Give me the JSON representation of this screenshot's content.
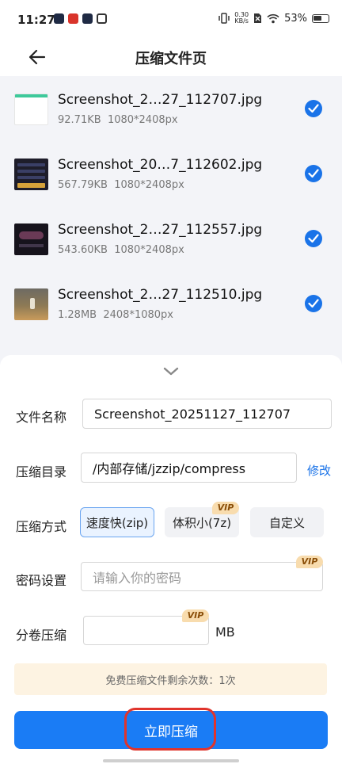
{
  "status": {
    "time": "11:27",
    "net_speed_value": "0.30",
    "net_speed_unit": "KB/s",
    "battery": "53%"
  },
  "header": {
    "title": "压缩文件页"
  },
  "files": [
    {
      "name": "Screenshot_2…27_112707.jpg",
      "size": "92.71KB",
      "dims": "1080*2408px"
    },
    {
      "name": "Screenshot_20…7_112602.jpg",
      "size": "567.79KB",
      "dims": "1080*2408px"
    },
    {
      "name": "Screenshot_2…27_112557.jpg",
      "size": "543.60KB",
      "dims": "1080*2408px"
    },
    {
      "name": "Screenshot_2…27_112510.jpg",
      "size": "1.28MB",
      "dims": "2408*1080px"
    }
  ],
  "form": {
    "filename_label": "文件名称",
    "filename_value": "Screenshot_20251127_112707",
    "dir_label": "压缩目录",
    "dir_value": "/内部存储/jzzip/compress",
    "dir_edit": "修改",
    "method_label": "压缩方式",
    "methods": [
      "速度快(zip)",
      "体积小(7z)",
      "自定义"
    ],
    "vip": "VIP",
    "password_label": "密码设置",
    "password_placeholder": "请输入你的密码",
    "split_label": "分卷压缩",
    "split_unit": "MB"
  },
  "notice": "免费压缩文件剩余次数：1次",
  "action": {
    "compress_now": "立即压缩"
  },
  "colors": {
    "accent": "#1a7cf5",
    "highlight": "#e0342c",
    "vip_bg": "#f8dcae"
  }
}
